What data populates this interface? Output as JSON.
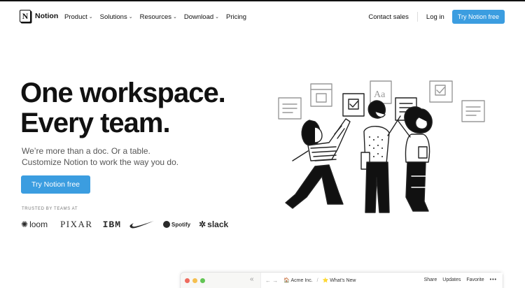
{
  "nav": {
    "logo_text": "Notion",
    "logo_glyph": "N",
    "menu": [
      {
        "label": "Product",
        "dropdown": true
      },
      {
        "label": "Solutions",
        "dropdown": true
      },
      {
        "label": "Resources",
        "dropdown": true
      },
      {
        "label": "Download",
        "dropdown": true
      },
      {
        "label": "Pricing",
        "dropdown": false
      }
    ],
    "contact_sales": "Contact sales",
    "login": "Log in",
    "cta": "Try Notion free"
  },
  "hero": {
    "headline_line1": "One workspace.",
    "headline_line2": "Every team.",
    "sub_line1": "We’re more than a doc. Or a table.",
    "sub_line2": "Customize Notion to work the way you do.",
    "cta": "Try Notion free"
  },
  "trusted": {
    "label": "TRUSTED BY TEAMS AT",
    "brands": [
      "loom",
      "PIXAR",
      "IBM",
      "nike-swoosh",
      "Spotify",
      "slack"
    ]
  },
  "preview": {
    "crumb1": "Acme Inc.",
    "crumb2": "What’s New",
    "actions": [
      "Share",
      "Updates",
      "Favorite"
    ],
    "more": "•••"
  },
  "colors": {
    "accent": "#3b9de0",
    "text": "#111111",
    "muted": "#555555"
  }
}
